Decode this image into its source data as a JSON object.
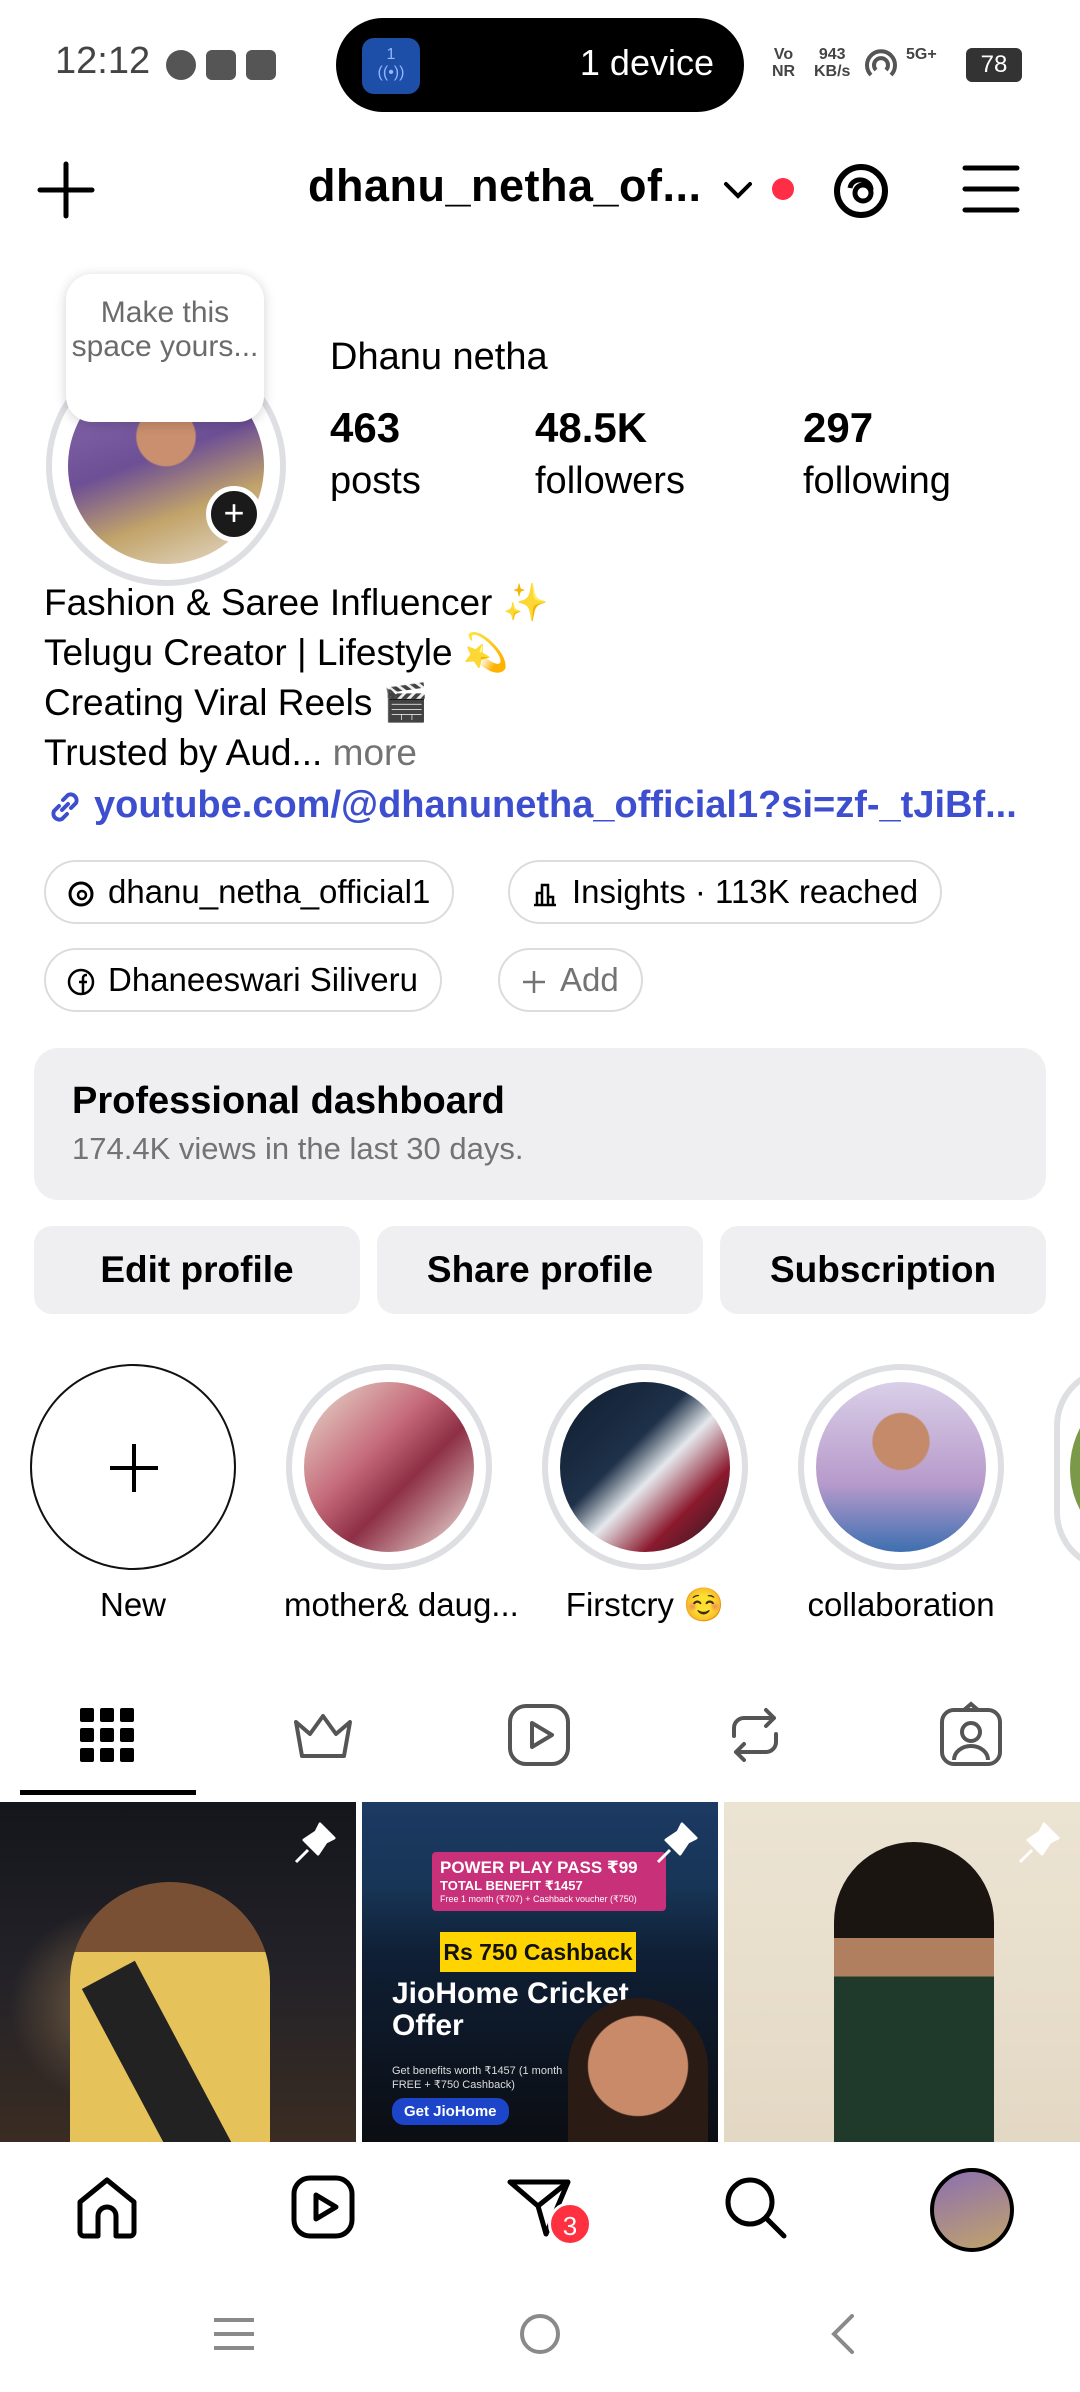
{
  "status_bar": {
    "time": "12:12",
    "device_label": "1 device",
    "device_icon_text": "1",
    "network_left": "Vo\nNR",
    "speed": "943\nKB/s",
    "signal": "5G+",
    "battery": "78"
  },
  "header": {
    "username": "dhanu_netha_of...",
    "create_icon": "plus-icon",
    "threads_icon": "threads-icon",
    "menu_icon": "hamburger-menu-icon"
  },
  "profile": {
    "note": "Make this space yours...",
    "display_name": "Dhanu netha",
    "stats": [
      {
        "value": "463",
        "label": "posts"
      },
      {
        "value": "48.5K",
        "label": "followers"
      },
      {
        "value": "297",
        "label": "following"
      }
    ],
    "bio_lines": [
      "Fashion & Saree Influencer ✨",
      "Telugu Creator | Lifestyle 💫",
      "Creating Viral Reels 🎬",
      "Trusted by Aud..."
    ],
    "bio_more": " more",
    "link": "youtube.com/@dhanunetha_official1?si=zf-_tJiBf..."
  },
  "chips": {
    "threads": "dhanu_netha_official1",
    "insights": "Insights · 113K reached",
    "facebook": "Dhaneeswari Siliveru",
    "add": "Add"
  },
  "dashboard": {
    "title": "Professional dashboard",
    "subtitle": "174.4K views in the last 30 days."
  },
  "buttons": {
    "edit": "Edit profile",
    "share": "Share profile",
    "subscription": "Subscription"
  },
  "highlights": [
    {
      "label": "New"
    },
    {
      "label": "mother& daug..."
    },
    {
      "label": "Firstcry ☺️"
    },
    {
      "label": "collaboration"
    }
  ],
  "posts": {
    "post2": {
      "banner_line1": "POWER PLAY PASS ₹99",
      "banner_line2": "TOTAL BENEFIT ₹1457",
      "banner_line3": "Free 1 month (₹707) + Cashback voucher (₹750)",
      "cashback": "Rs 750 Cashback",
      "title": "JioHome Cricket Offer",
      "small": "Get benefits worth ₹1457 (1 month FREE + ₹750 Cashback)",
      "cta": "Get JioHome"
    }
  },
  "bottom_nav": {
    "badge": "3"
  },
  "colors": {
    "link": "#3d4fcf",
    "badge": "#ff3040",
    "surface": "#efeff1"
  }
}
